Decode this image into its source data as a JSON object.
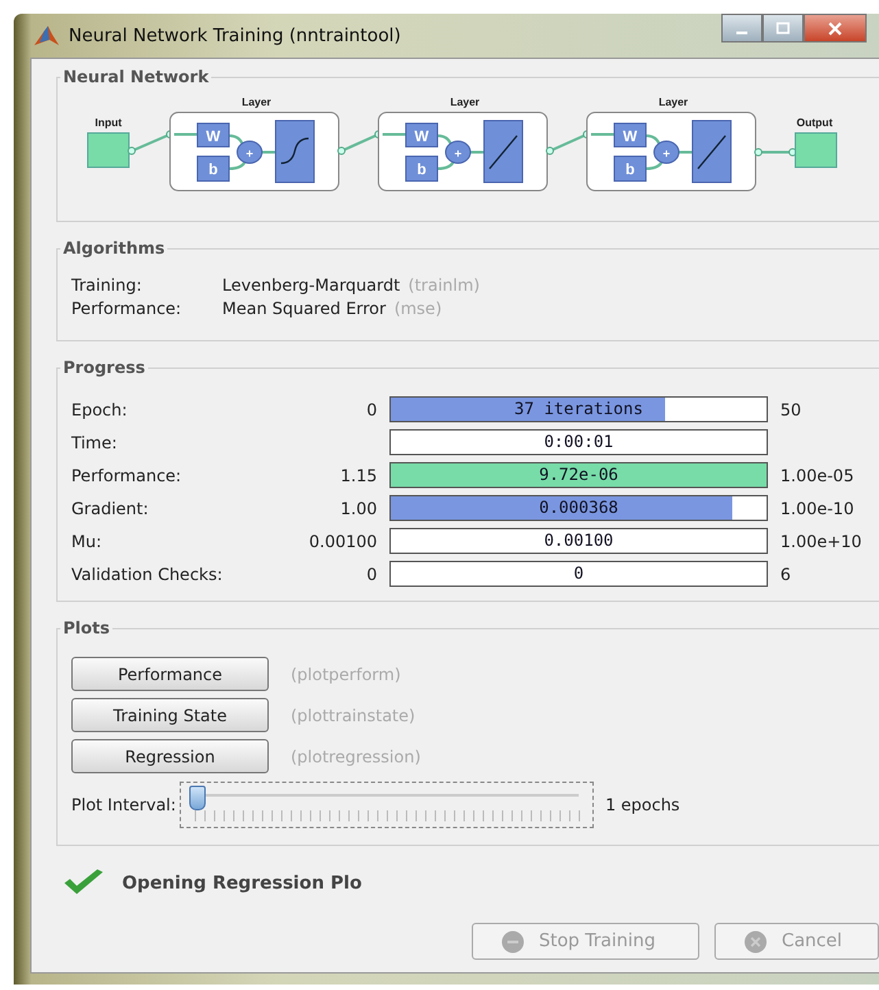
{
  "window": {
    "title": "Neural Network Training (nntraintool)"
  },
  "network": {
    "title": "Neural Network",
    "input": "Input",
    "output": "Output",
    "layers": [
      {
        "label": "Layer",
        "weight": "W",
        "bias": "b",
        "sum": "+",
        "kind": "sigmoid"
      },
      {
        "label": "Layer",
        "weight": "W",
        "bias": "b",
        "sum": "+",
        "kind": "linear"
      },
      {
        "label": "Layer",
        "weight": "W",
        "bias": "b",
        "sum": "+",
        "kind": "linear"
      }
    ]
  },
  "algorithms": {
    "title": "Algorithms",
    "rows": [
      {
        "label": "Training:",
        "value": "Levenberg-Marquardt",
        "code": "(trainlm)"
      },
      {
        "label": "Performance:",
        "value": "Mean Squared Error",
        "code": "(mse)"
      }
    ]
  },
  "progress": {
    "title": "Progress",
    "rows": [
      {
        "label": "Epoch:",
        "start": "0",
        "value": "37 iterations",
        "end": "50",
        "level": 0.73,
        "color": "#7a96e0"
      },
      {
        "label": "Time:",
        "value": "0:00:01"
      },
      {
        "label": "Performance:",
        "start": "1.15",
        "value": "9.72e-06",
        "end": "1.00e-05",
        "level": 1,
        "color": "#77dca8"
      },
      {
        "label": "Gradient:",
        "start": "1.00",
        "value": "0.000368",
        "end": "1.00e-10",
        "level": 0.91,
        "color": "#7a96e0"
      },
      {
        "label": "Mu:",
        "start": "0.00100",
        "value": "0.00100",
        "end": "1.00e+10"
      },
      {
        "label": "Validation Checks:",
        "start": "0",
        "value": "0",
        "end": "6"
      }
    ]
  },
  "plots": {
    "title": "Plots",
    "buttons": [
      {
        "label": "Performance",
        "function": "(plotperform)"
      },
      {
        "label": "Training State",
        "function": "(plottrainstate)"
      },
      {
        "label": "Regression",
        "function": "(plotregression)"
      }
    ],
    "interval": {
      "label": "Plot Interval:",
      "level": 0,
      "reading": "1 epochs"
    }
  },
  "status": "Opening Regression Plo",
  "buttons": [
    {
      "label": "Stop Training",
      "kind": "stop",
      "disabled": true
    },
    {
      "label": "Cancel",
      "kind": "cancel",
      "disabled": true
    }
  ]
}
